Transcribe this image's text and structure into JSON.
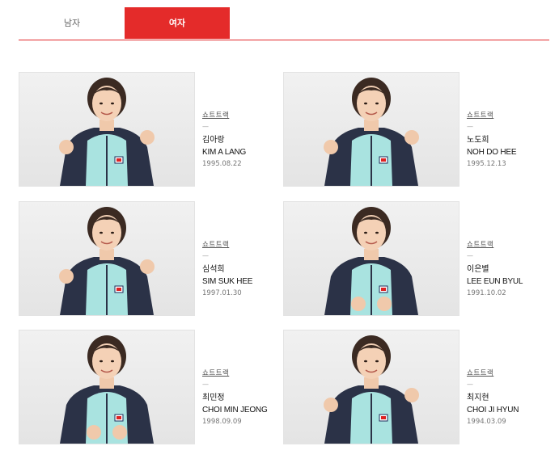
{
  "tabs": [
    {
      "label": "남자",
      "active": false
    },
    {
      "label": "여자",
      "active": true
    }
  ],
  "accent_color": "#e42b2a",
  "athletes": [
    {
      "sport": "쇼트트랙",
      "sub": "—",
      "name_ko": "김아랑",
      "name_en": "KIM A LANG",
      "birth": "1995.08.22",
      "photo": "athlete-photo-fist-pump"
    },
    {
      "sport": "쇼트트랙",
      "sub": "—",
      "name_ko": "노도희",
      "name_en": "NOH DO HEE",
      "birth": "1995.12.13",
      "photo": "athlete-photo-thumbs-up"
    },
    {
      "sport": "쇼트트랙",
      "sub": "—",
      "name_ko": "심석희",
      "name_en": "SIM SUK HEE",
      "birth": "1997.01.30",
      "photo": "athlete-photo-thumbs-up-glasses"
    },
    {
      "sport": "쇼트트랙",
      "sub": "—",
      "name_ko": "이은별",
      "name_en": "LEE EUN BYUL",
      "birth": "1991.10.02",
      "photo": "athlete-photo-arms-crossed"
    },
    {
      "sport": "쇼트트랙",
      "sub": "—",
      "name_ko": "최민정",
      "name_en": "CHOI MIN JEONG",
      "birth": "1998.09.09",
      "photo": "athlete-photo-arms-crossed"
    },
    {
      "sport": "쇼트트랙",
      "sub": "—",
      "name_ko": "최지현",
      "name_en": "CHOI JI HYUN",
      "birth": "1994.03.09",
      "photo": "athlete-photo-fist-pump"
    }
  ]
}
